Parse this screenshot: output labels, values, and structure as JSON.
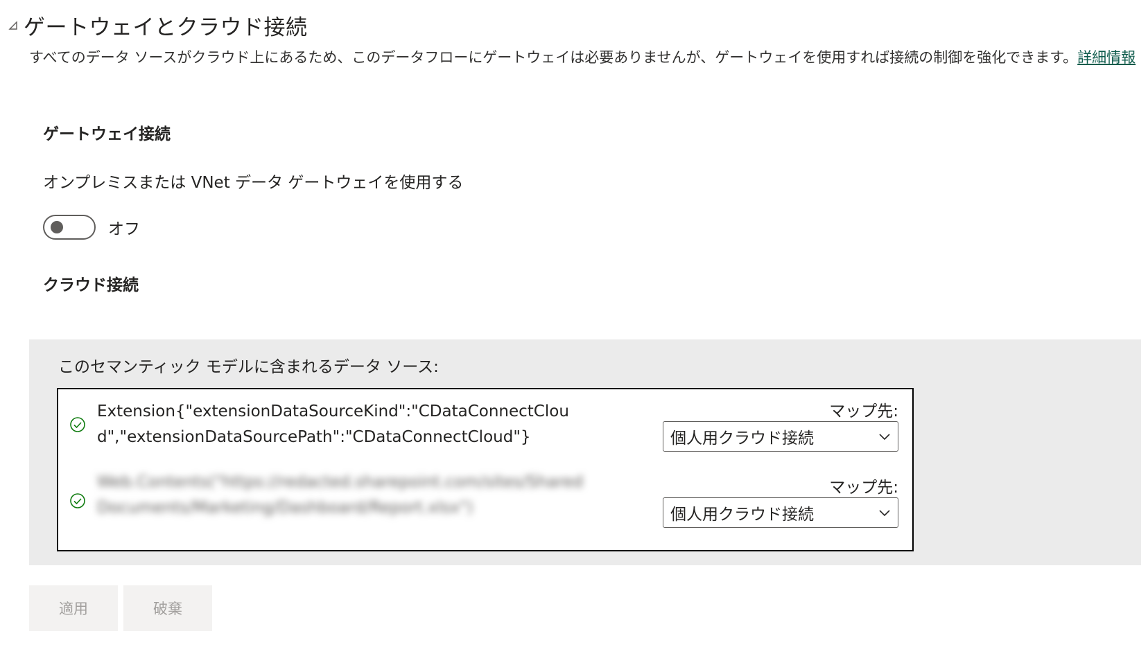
{
  "section": {
    "title": "ゲートウェイとクラウド接続",
    "collapse_icon": "triangle-collapse-icon"
  },
  "description": {
    "text": "すべてのデータ ソースがクラウド上にあるため、このデータフローにゲートウェイは必要ありませんが、ゲートウェイを使用すれば接続の制御を強化できます。",
    "link": "詳細情報"
  },
  "gateway": {
    "heading": "ゲートウェイ接続",
    "toggle_label": "オンプレミスまたは VNet データ ゲートウェイを使用する",
    "toggle_state": "オフ",
    "toggle_on": false
  },
  "cloud": {
    "heading": "クラウド接続",
    "caption": "このセマンティック モデルに含まれるデータ ソース:",
    "sources": [
      {
        "name": "Extension{\"extensionDataSourceKind\":\"CDataConnectCloud\",\"extensionDataSourcePath\":\"CDataConnectCloud\"}",
        "map_label": "マップ先:",
        "map_value": "個人用クラウド接続",
        "status_icon": "check-circle-icon",
        "blurred": false
      },
      {
        "name": "Web.Contents(\"https://redacted.sharepoint.com/sites/Shared Documents/Marketing/Dashboard/Report.xlsx\")",
        "map_label": "マップ先:",
        "map_value": "個人用クラウド接続",
        "status_icon": "check-circle-icon",
        "blurred": true
      }
    ]
  },
  "buttons": {
    "apply": "適用",
    "discard": "破棄"
  },
  "colors": {
    "link": "#0e5c4c",
    "check": "#107c10",
    "panel_bg": "#ebebeb",
    "button_bg": "#f3f2f1",
    "button_text_disabled": "#a19f9d"
  }
}
